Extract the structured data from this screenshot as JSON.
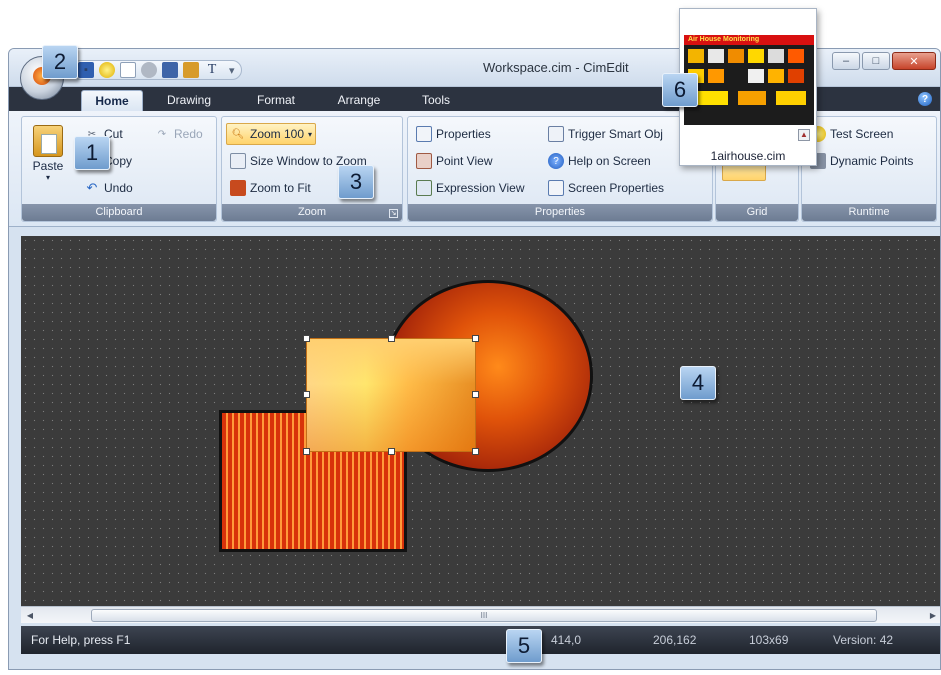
{
  "window": {
    "title": "Workspace.cim - CimEdit"
  },
  "quick_access": {
    "icons": [
      "save-icon",
      "lightbulb-icon",
      "new-document-icon",
      "print-icon",
      "screen-icon",
      "settings-icon",
      "text-icon"
    ],
    "text_glyph": "T",
    "more_glyph": "▾"
  },
  "tabs": [
    {
      "label": "Home",
      "active": true
    },
    {
      "label": "Drawing"
    },
    {
      "label": "Format"
    },
    {
      "label": "Arrange"
    },
    {
      "label": "Tools"
    }
  ],
  "ribbon": {
    "clipboard": {
      "label": "Clipboard",
      "paste": "Paste",
      "cut": "Cut",
      "copy": "Copy",
      "undo": "Undo",
      "redo": "Redo"
    },
    "zoom": {
      "label": "Zoom",
      "zoom100": "Zoom 100",
      "size_window": "Size Window to Zoom",
      "zoom_fit": "Zoom to Fit"
    },
    "properties": {
      "label": "Properties",
      "properties": "Properties",
      "point_view": "Point View",
      "expression_view": "Expression View",
      "trigger_smart": "Trigger Smart Obj",
      "help_on_screen": "Help on Screen",
      "screen_properties": "Screen Properties"
    },
    "grid": {
      "label": "Grid"
    },
    "runtime": {
      "label": "Runtime",
      "test_screen": "Test Screen",
      "dynamic_points": "Dynamic Points"
    }
  },
  "thumbnail": {
    "caption": "1airhouse.cim",
    "banner": "Air House Monitoring"
  },
  "status": {
    "help": "For Help, press F1",
    "pos1": "414,0",
    "pos2": "206,162",
    "size": "103x69",
    "version": "Version: 42"
  },
  "scrollbar": {
    "grip": "III"
  },
  "callouts": [
    "1",
    "2",
    "3",
    "4",
    "5",
    "6"
  ],
  "colors": {
    "title_gradient_top": "#e9f0f9",
    "tabstrip": "#2c3340",
    "canvas_bg": "#3b3b3b",
    "statusbar": "#2a303a",
    "callout_blue": "#8fb4de"
  }
}
